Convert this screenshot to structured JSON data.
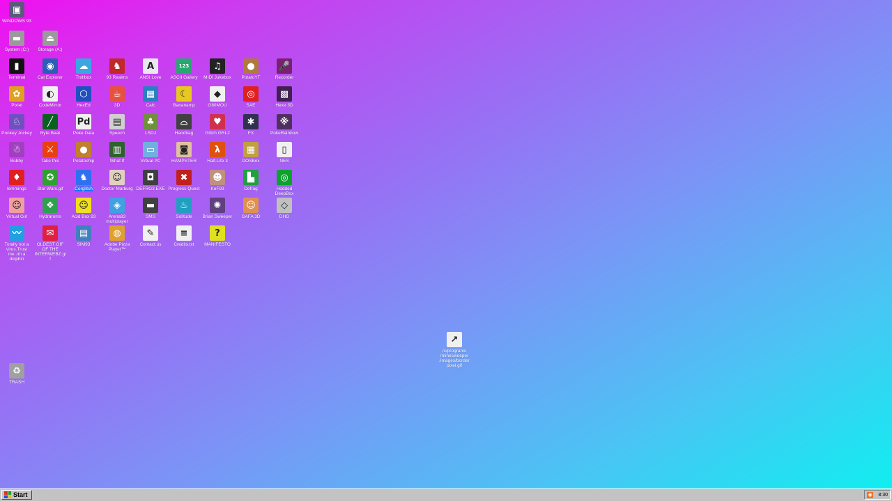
{
  "desktop": {
    "icons": [
      {
        "name": "icon-windows93",
        "label": "WINDOWS 93",
        "glyph": "▣",
        "bg": "#5a5a7a"
      },
      {
        "name": "icon-system-c",
        "label": "System (C:)",
        "glyph": "▬",
        "bg": "#9a9a9a"
      },
      {
        "name": "icon-storage-a",
        "label": "Storage (A:)",
        "glyph": "⏏",
        "bg": "#9a9a9a"
      },
      {
        "name": "icon-terminal",
        "label": "Terminal",
        "glyph": "▮",
        "bg": "#111111"
      },
      {
        "name": "icon-cat-explorer",
        "label": "Cat Explorer",
        "glyph": "◉",
        "bg": "#2b5fb5"
      },
      {
        "name": "icon-trollbox",
        "label": "Trollbox",
        "glyph": "☁",
        "bg": "#3aa7e0"
      },
      {
        "name": "icon-93-realms",
        "label": "93 Realms",
        "glyph": "♞",
        "bg": "#c0282a"
      },
      {
        "name": "icon-ansi-love",
        "label": "ANSI Love",
        "glyph": "A",
        "bg": "#e8e8f0"
      },
      {
        "name": "icon-ascii-gallery",
        "label": "ASCII Gallery",
        "glyph": "123",
        "bg": "#28a870"
      },
      {
        "name": "icon-midi-jukebox",
        "label": "MIDI Jukebox",
        "glyph": "♫",
        "bg": "#222222"
      },
      {
        "name": "icon-potatoyt",
        "label": "PotatoYT",
        "glyph": "●",
        "bg": "#b07a3e"
      },
      {
        "name": "icon-recorder",
        "label": "Recorder",
        "glyph": "🎤",
        "bg": "#7a2070"
      },
      {
        "name": "icon-pixiel",
        "label": "Pixiel",
        "glyph": "✿",
        "bg": "#e0a020"
      },
      {
        "name": "icon-codemirror",
        "label": "CodeMirror",
        "glyph": "◐",
        "bg": "#f0f0f0"
      },
      {
        "name": "icon-hexed",
        "label": "HexEd",
        "glyph": "⬡",
        "bg": "#2050c0"
      },
      {
        "name": "icon-3d",
        "label": "3D",
        "glyph": "☕",
        "bg": "#e85040"
      },
      {
        "name": "icon-calc",
        "label": "Calc",
        "glyph": "▦",
        "bg": "#2880c0"
      },
      {
        "name": "icon-bananamp",
        "label": "Bananamp",
        "glyph": "☾",
        "bg": "#e8c820"
      },
      {
        "name": "icon-g80mou",
        "label": "G80MOU",
        "glyph": "◆",
        "bg": "#f0f0f0"
      },
      {
        "name": "icon-sae",
        "label": "SAE",
        "glyph": "◎",
        "bg": "#e02020"
      },
      {
        "name": "icon-hexe-3d",
        "label": "Hexe 3D",
        "glyph": "▩",
        "bg": "#402050"
      },
      {
        "name": "icon-ponkey-jockey",
        "label": "Ponkey Jockey",
        "glyph": "♘",
        "bg": "#7050c0"
      },
      {
        "name": "icon-byte-beat",
        "label": "Byte Beat",
        "glyph": "╱",
        "bg": "#0a6020"
      },
      {
        "name": "icon-poke-data",
        "label": "Poke Data",
        "glyph": "Pd",
        "bg": "#f0f0f0"
      },
      {
        "name": "icon-speech",
        "label": "Speech",
        "glyph": "▤",
        "bg": "#d0d0d0"
      },
      {
        "name": "icon-lsdj",
        "label": "LSDJ",
        "glyph": "♣",
        "bg": "#70903a"
      },
      {
        "name": "icon-glitch-girl",
        "label": "Handbag",
        "glyph": "⌓",
        "bg": "#404040"
      },
      {
        "name": "icon-glitch-grl-2",
        "label": "Glitch GRL2",
        "glyph": "♥",
        "bg": "#d03050"
      },
      {
        "name": "icon-fx",
        "label": "FX",
        "glyph": "✱",
        "bg": "#303050"
      },
      {
        "name": "icon-pokerainbow",
        "label": "PokeRainbow",
        "glyph": "※",
        "bg": "#503060"
      },
      {
        "name": "icon-bubby",
        "label": "Bubby",
        "glyph": "☃",
        "bg": "#a040c0"
      },
      {
        "name": "icon-take-this",
        "label": "Take this",
        "glyph": "⚔",
        "bg": "#e84010"
      },
      {
        "name": "icon-potato-chip",
        "label": "Potatochip",
        "glyph": "●",
        "bg": "#c08030"
      },
      {
        "name": "icon-what-if",
        "label": "What If",
        "glyph": "▥",
        "bg": "#306030"
      },
      {
        "name": "icon-virtual-pc",
        "label": "Virtual PC",
        "glyph": "▭",
        "bg": "#70b0e0"
      },
      {
        "name": "icon-hampster",
        "label": "HAMPSTER",
        "glyph": "◙",
        "bg": "#e0c0a0"
      },
      {
        "name": "icon-half-life-3",
        "label": "Half-Life 3",
        "glyph": "λ",
        "bg": "#e05010"
      },
      {
        "name": "icon-dosbox",
        "label": "DOSBox",
        "glyph": "▦",
        "bg": "#c0a040"
      },
      {
        "name": "icon-nes",
        "label": "NES",
        "glyph": "▯",
        "bg": "#f0f0f0"
      },
      {
        "name": "icon-lemmings",
        "label": "lemmings",
        "glyph": "♦",
        "bg": "#e02020"
      },
      {
        "name": "icon-star-wars",
        "label": "Star Wars.gif",
        "glyph": "✪",
        "bg": "#30a030"
      },
      {
        "name": "icon-corglitch",
        "label": "Corglitch",
        "glyph": "♞",
        "bg": "#3070f0"
      },
      {
        "name": "icon-doctor-marburg",
        "label": "Doctor Marburg",
        "glyph": "☺",
        "bg": "#e0d0c0"
      },
      {
        "name": "icon-defrg",
        "label": "DEFRG3.EXE",
        "glyph": "◘",
        "bg": "#404040"
      },
      {
        "name": "icon-progress-quest",
        "label": "Progress Quest",
        "glyph": "✖",
        "bg": "#c02020"
      },
      {
        "name": "icon-kof93",
        "label": "KoF93",
        "glyph": "☻",
        "bg": "#c09080"
      },
      {
        "name": "icon-defrag",
        "label": "Defrag",
        "glyph": "▙",
        "bg": "#20a040"
      },
      {
        "name": "icon-hodded-deepbox",
        "label": "Hodded DeepBox",
        "glyph": "◎",
        "bg": "#10a030"
      },
      {
        "name": "icon-virtual-girl",
        "label": "Virtual Girl",
        "glyph": "☺",
        "bg": "#f0a0a0"
      },
      {
        "name": "icon-hydraroms",
        "label": "Hydraroms",
        "glyph": "❖",
        "bg": "#30a050"
      },
      {
        "name": "icon-acid-box-93",
        "label": "Acid Box 93",
        "glyph": "☺",
        "bg": "#f0e020"
      },
      {
        "name": "icon-arena93",
        "label": "Arena93 multiplayer",
        "glyph": "◈",
        "bg": "#40a0e0"
      },
      {
        "name": "icon-sms",
        "label": "SMS",
        "glyph": "▬",
        "bg": "#404040"
      },
      {
        "name": "icon-solitude",
        "label": "Solitude",
        "glyph": "♨",
        "bg": "#20a0c0"
      },
      {
        "name": "icon-brian-sweeper",
        "label": "Brian Sweeper",
        "glyph": "✺",
        "bg": "#604080"
      },
      {
        "name": "icon-gafa-3d",
        "label": "GAFA 3D",
        "glyph": "☺",
        "bg": "#e09050"
      },
      {
        "name": "icon-dhg",
        "label": "DHG",
        "glyph": "◇",
        "bg": "#c0c0c0"
      },
      {
        "name": "icon-totally-not-a-virus",
        "label": "Totally not a virus.Trust me..im a dolphin",
        "glyph": "〰",
        "bg": "#20a0e0"
      },
      {
        "name": "icon-oldest-gif",
        "label": "OLDEST GIF OF THE INTERWEBZ.gif",
        "glyph": "✉",
        "bg": "#e02040"
      },
      {
        "name": "icon-sim93",
        "label": "SIM93",
        "glyph": "▤",
        "bg": "#4080c0"
      },
      {
        "name": "icon-adobe-pizza",
        "label": "Adobe Pizza Player™",
        "glyph": "◍",
        "bg": "#e0a030"
      },
      {
        "name": "icon-contact-us",
        "label": "Contact.us",
        "glyph": "✎",
        "bg": "#f0f0f0"
      },
      {
        "name": "icon-credits",
        "label": "Credits.txt",
        "glyph": "≡",
        "bg": "#f0f0f0"
      },
      {
        "name": "icon-manifesto",
        "label": "MANIFESTO",
        "glyph": "?",
        "bg": "#e0e020"
      },
      {
        "name": "icon-trash",
        "label": "TRASH",
        "glyph": "♻",
        "bg": "#a0a0a0"
      },
      {
        "name": "icon-shortcut-gif",
        "label": "/c/programs /minesweeper /images/borderpixel.gif",
        "glyph": "↗",
        "bg": "#f0f0f0"
      }
    ]
  },
  "taskbar": {
    "start_label": "Start",
    "clock": "8:30"
  }
}
